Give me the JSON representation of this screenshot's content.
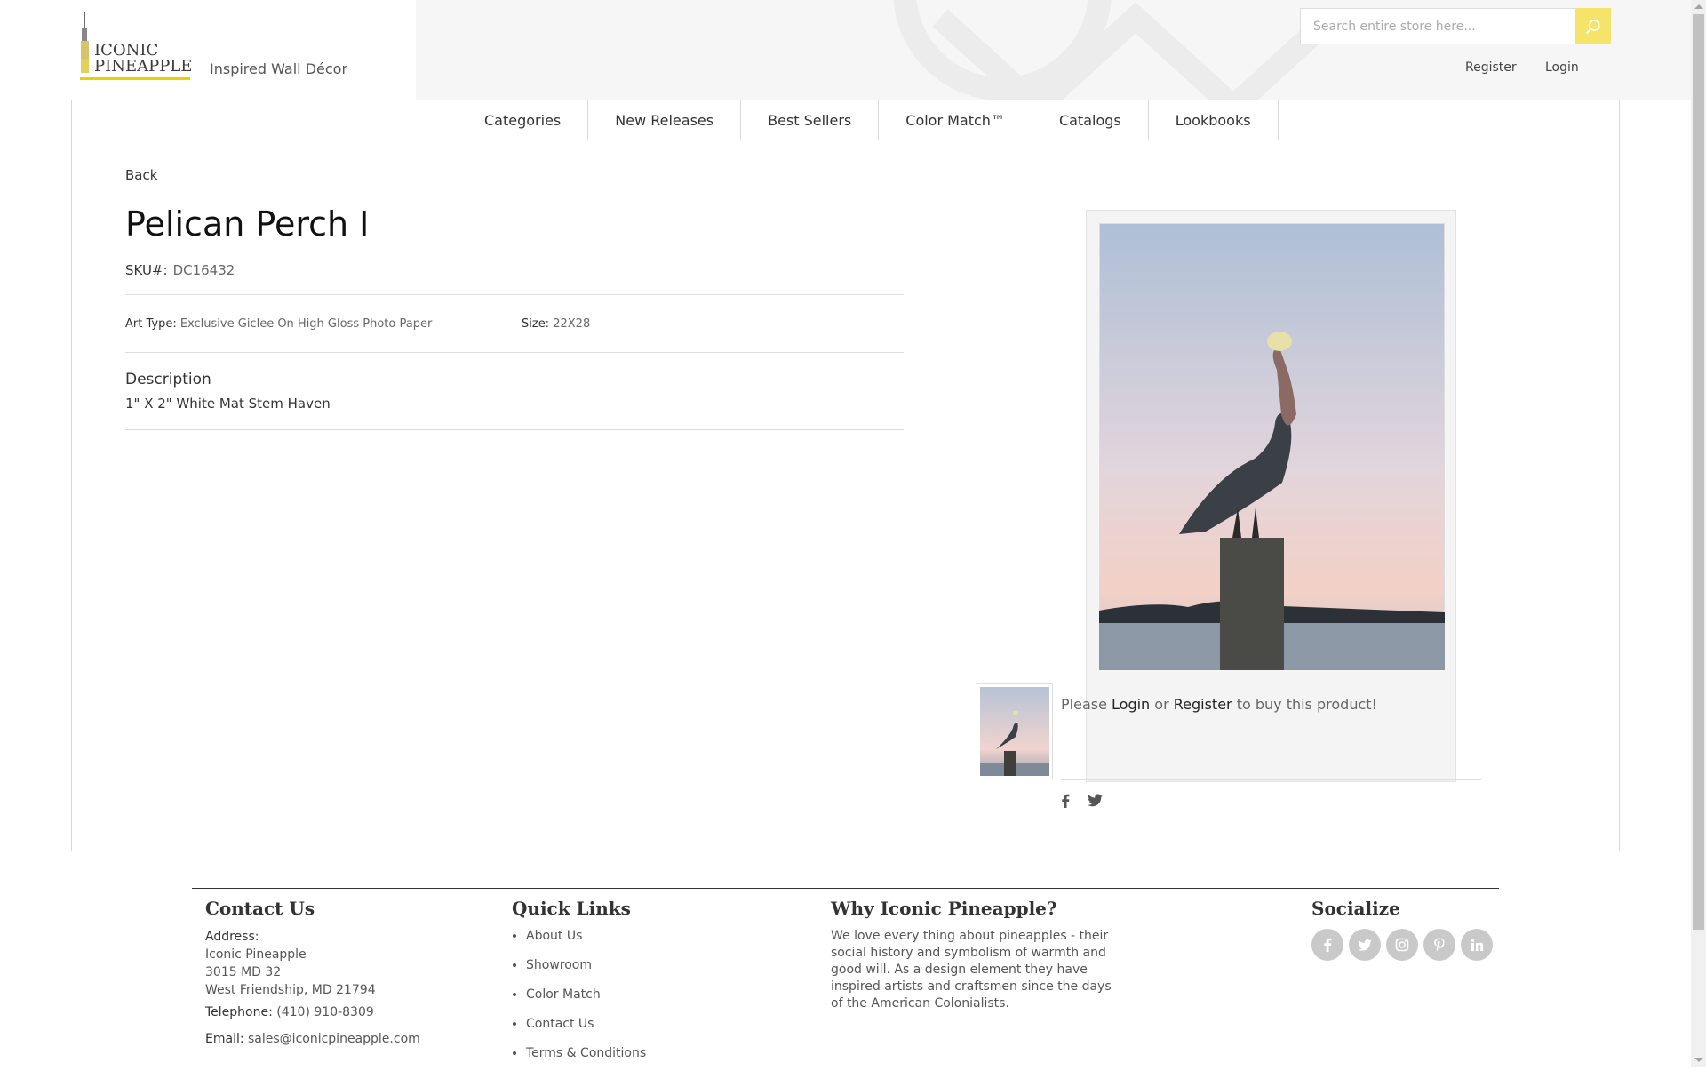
{
  "header": {
    "logo_line1": "ICONIC",
    "logo_line2": "PINEAPPLE",
    "tagline": "Inspired Wall Décor",
    "search_placeholder": "Search entire store here...",
    "register": "Register",
    "login": "Login",
    "accent_color": "#f5e36a"
  },
  "nav": {
    "items": [
      "Categories",
      "New Releases",
      "Best Sellers",
      "Color Match™",
      "Catalogs",
      "Lookbooks"
    ]
  },
  "product": {
    "back": "Back",
    "title": "Pelican Perch I",
    "sku_label": "SKU#:",
    "sku": "DC16432",
    "art_type_label": "Art Type:",
    "art_type": "Exclusive Giclee On High Gloss Photo Paper",
    "size_label": "Size:",
    "size": "22X28",
    "description_heading": "Description",
    "description": "1\" X 2\" White Mat Stem Haven",
    "buy_prefix": "Please",
    "buy_login": "Login",
    "buy_or": "or",
    "buy_register": "Register",
    "buy_suffix": "to buy this product!"
  },
  "footer": {
    "contact_heading": "Contact Us",
    "address_label": "Address:",
    "address_lines": [
      "Iconic Pineapple",
      "3015 MD 32",
      "West Friendship, MD 21794"
    ],
    "telephone_label": "Telephone:",
    "telephone": "(410) 910-8309",
    "email_label": "Email:",
    "email": "sales@iconicpineapple.com",
    "quick_links_heading": "Quick Links",
    "quick_links": [
      "About Us",
      "Showroom",
      "Color Match",
      "Contact Us",
      "Terms & Conditions"
    ],
    "why_heading": "Why Iconic Pineapple?",
    "why_text": "We love every thing about pineapples - their social history and symbolism of warmth and good will. As a design element they have inspired artists and craftsmen since the days of the American Colonialists.",
    "socialize_heading": "Socialize",
    "social_icons": [
      "facebook-icon",
      "twitter-icon",
      "instagram-icon",
      "pinterest-icon",
      "linkedin-icon"
    ]
  }
}
